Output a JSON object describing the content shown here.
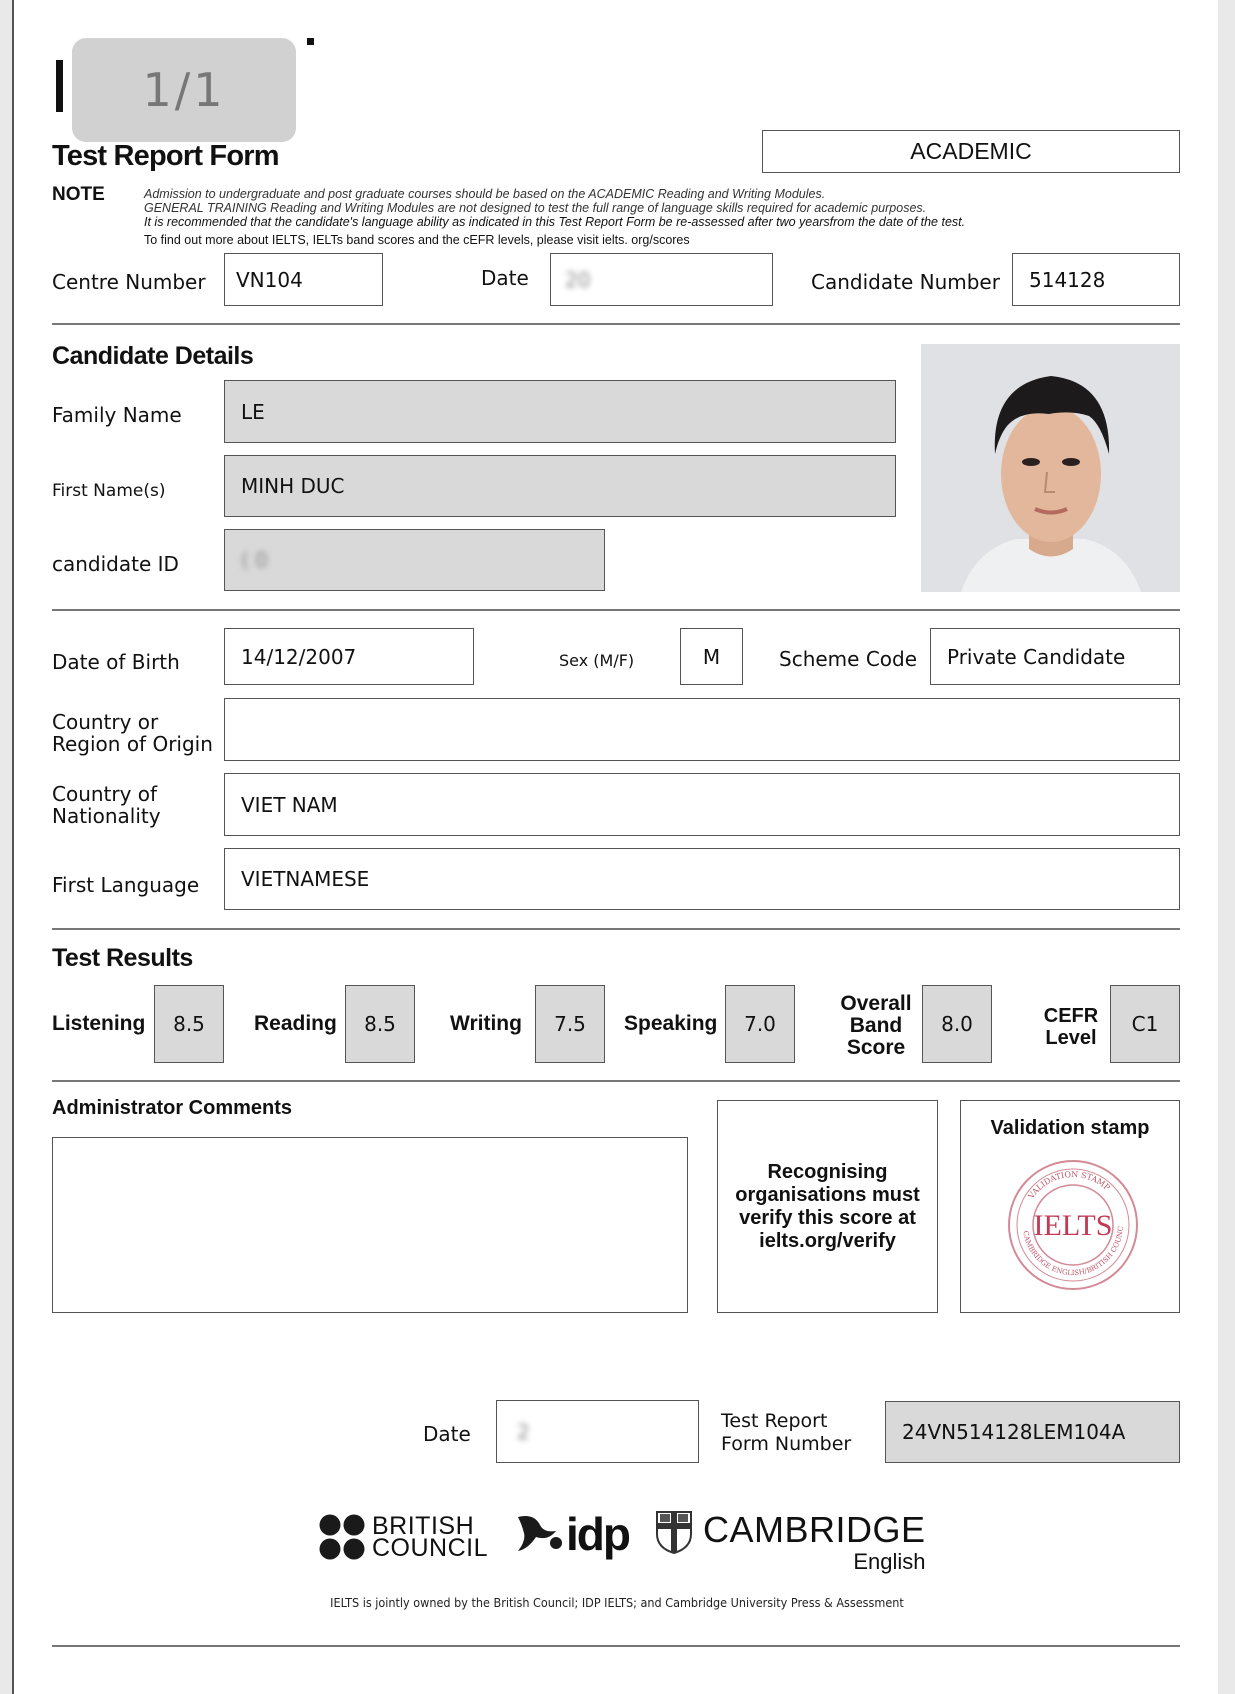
{
  "viewer": {
    "page_indicator": "1/1"
  },
  "form": {
    "title": "Test Report Form",
    "module": "ACADEMIC",
    "note_label": "NOTE",
    "notes": [
      "Admission to undergraduate and post graduate courses should be based on the ACADEMIC Reading and Writing Modules.",
      "GENERAL TRAINING Reading and Writing Modules are not designed to test the full range of language skills required for academic purposes.",
      "It is recommended that the candidate's language ability as indicated in this Test Report Form be re-assessed after two yearsfrom the date of the test.",
      "To find out more about IELTS, IELTs band scores and the cEFR levels, please visit ielts. org/scores"
    ]
  },
  "header_fields": {
    "centre_number_label": "Centre Number",
    "centre_number": "VN104",
    "date_label": "Date",
    "date_value": "20",
    "candidate_number_label": "Candidate Number",
    "candidate_number": "514128"
  },
  "candidate": {
    "section_title": "Candidate Details",
    "family_name_label": "Family Name",
    "family_name": "LE",
    "first_name_label": "First Name(s)",
    "first_name": "MINH DUC",
    "candidate_id_label": "candidate ID",
    "candidate_id": "( 0",
    "dob_label": "Date of Birth",
    "dob": "14/12/2007",
    "sex_label": "Sex (M/F)",
    "sex": "M",
    "scheme_code_label": "Scheme Code",
    "scheme_code": "Private Candidate",
    "country_origin_label_1": "Country or",
    "country_origin_label_2": "Region of Origin",
    "country_origin": "",
    "nationality_label_1": "Country of",
    "nationality_label_2": "Nationality",
    "nationality": "VIET NAM",
    "first_language_label": "First Language",
    "first_language": "VIETNAMESE"
  },
  "results": {
    "section_title": "Test Results",
    "listening_label": "Listening",
    "listening": "8.5",
    "reading_label": "Reading",
    "reading": "8.5",
    "writing_label": "Writing",
    "writing": "7.5",
    "speaking_label": "Speaking",
    "speaking": "7.0",
    "overall_label_1": "Overall",
    "overall_label_2": "Band",
    "overall_label_3": "Score",
    "overall": "8.0",
    "cefr_label_1": "CEFR",
    "cefr_label_2": "Level",
    "cefr": "C1"
  },
  "admin": {
    "comments_title": "Administrator Comments",
    "verify_lines": [
      "Recognising",
      "organisations must",
      "verify this score at",
      "ielts.org/verify"
    ],
    "stamp_title": "Validation stamp",
    "stamp_text": "IELTS",
    "stamp_ring_top": "VALIDATION STAMP",
    "stamp_ring_bottom": "CAMBRIDGE ENGLISH/BRITISH COUNCIL"
  },
  "footer": {
    "date_label": "Date",
    "date_value": "2",
    "trf_label_1": "Test Report",
    "trf_label_2": "Form Number",
    "trf_number": "24VN514128LEM104A",
    "british_council_1": "BRITISH",
    "british_council_2": "COUNCIL",
    "idp": "idp",
    "cambridge": "CAMBRIDGE",
    "cambridge_sub": "English",
    "ownership": "IELTS is jointly owned by the British Council; IDP IELTS; and Cambridge University Press & Assessment"
  }
}
